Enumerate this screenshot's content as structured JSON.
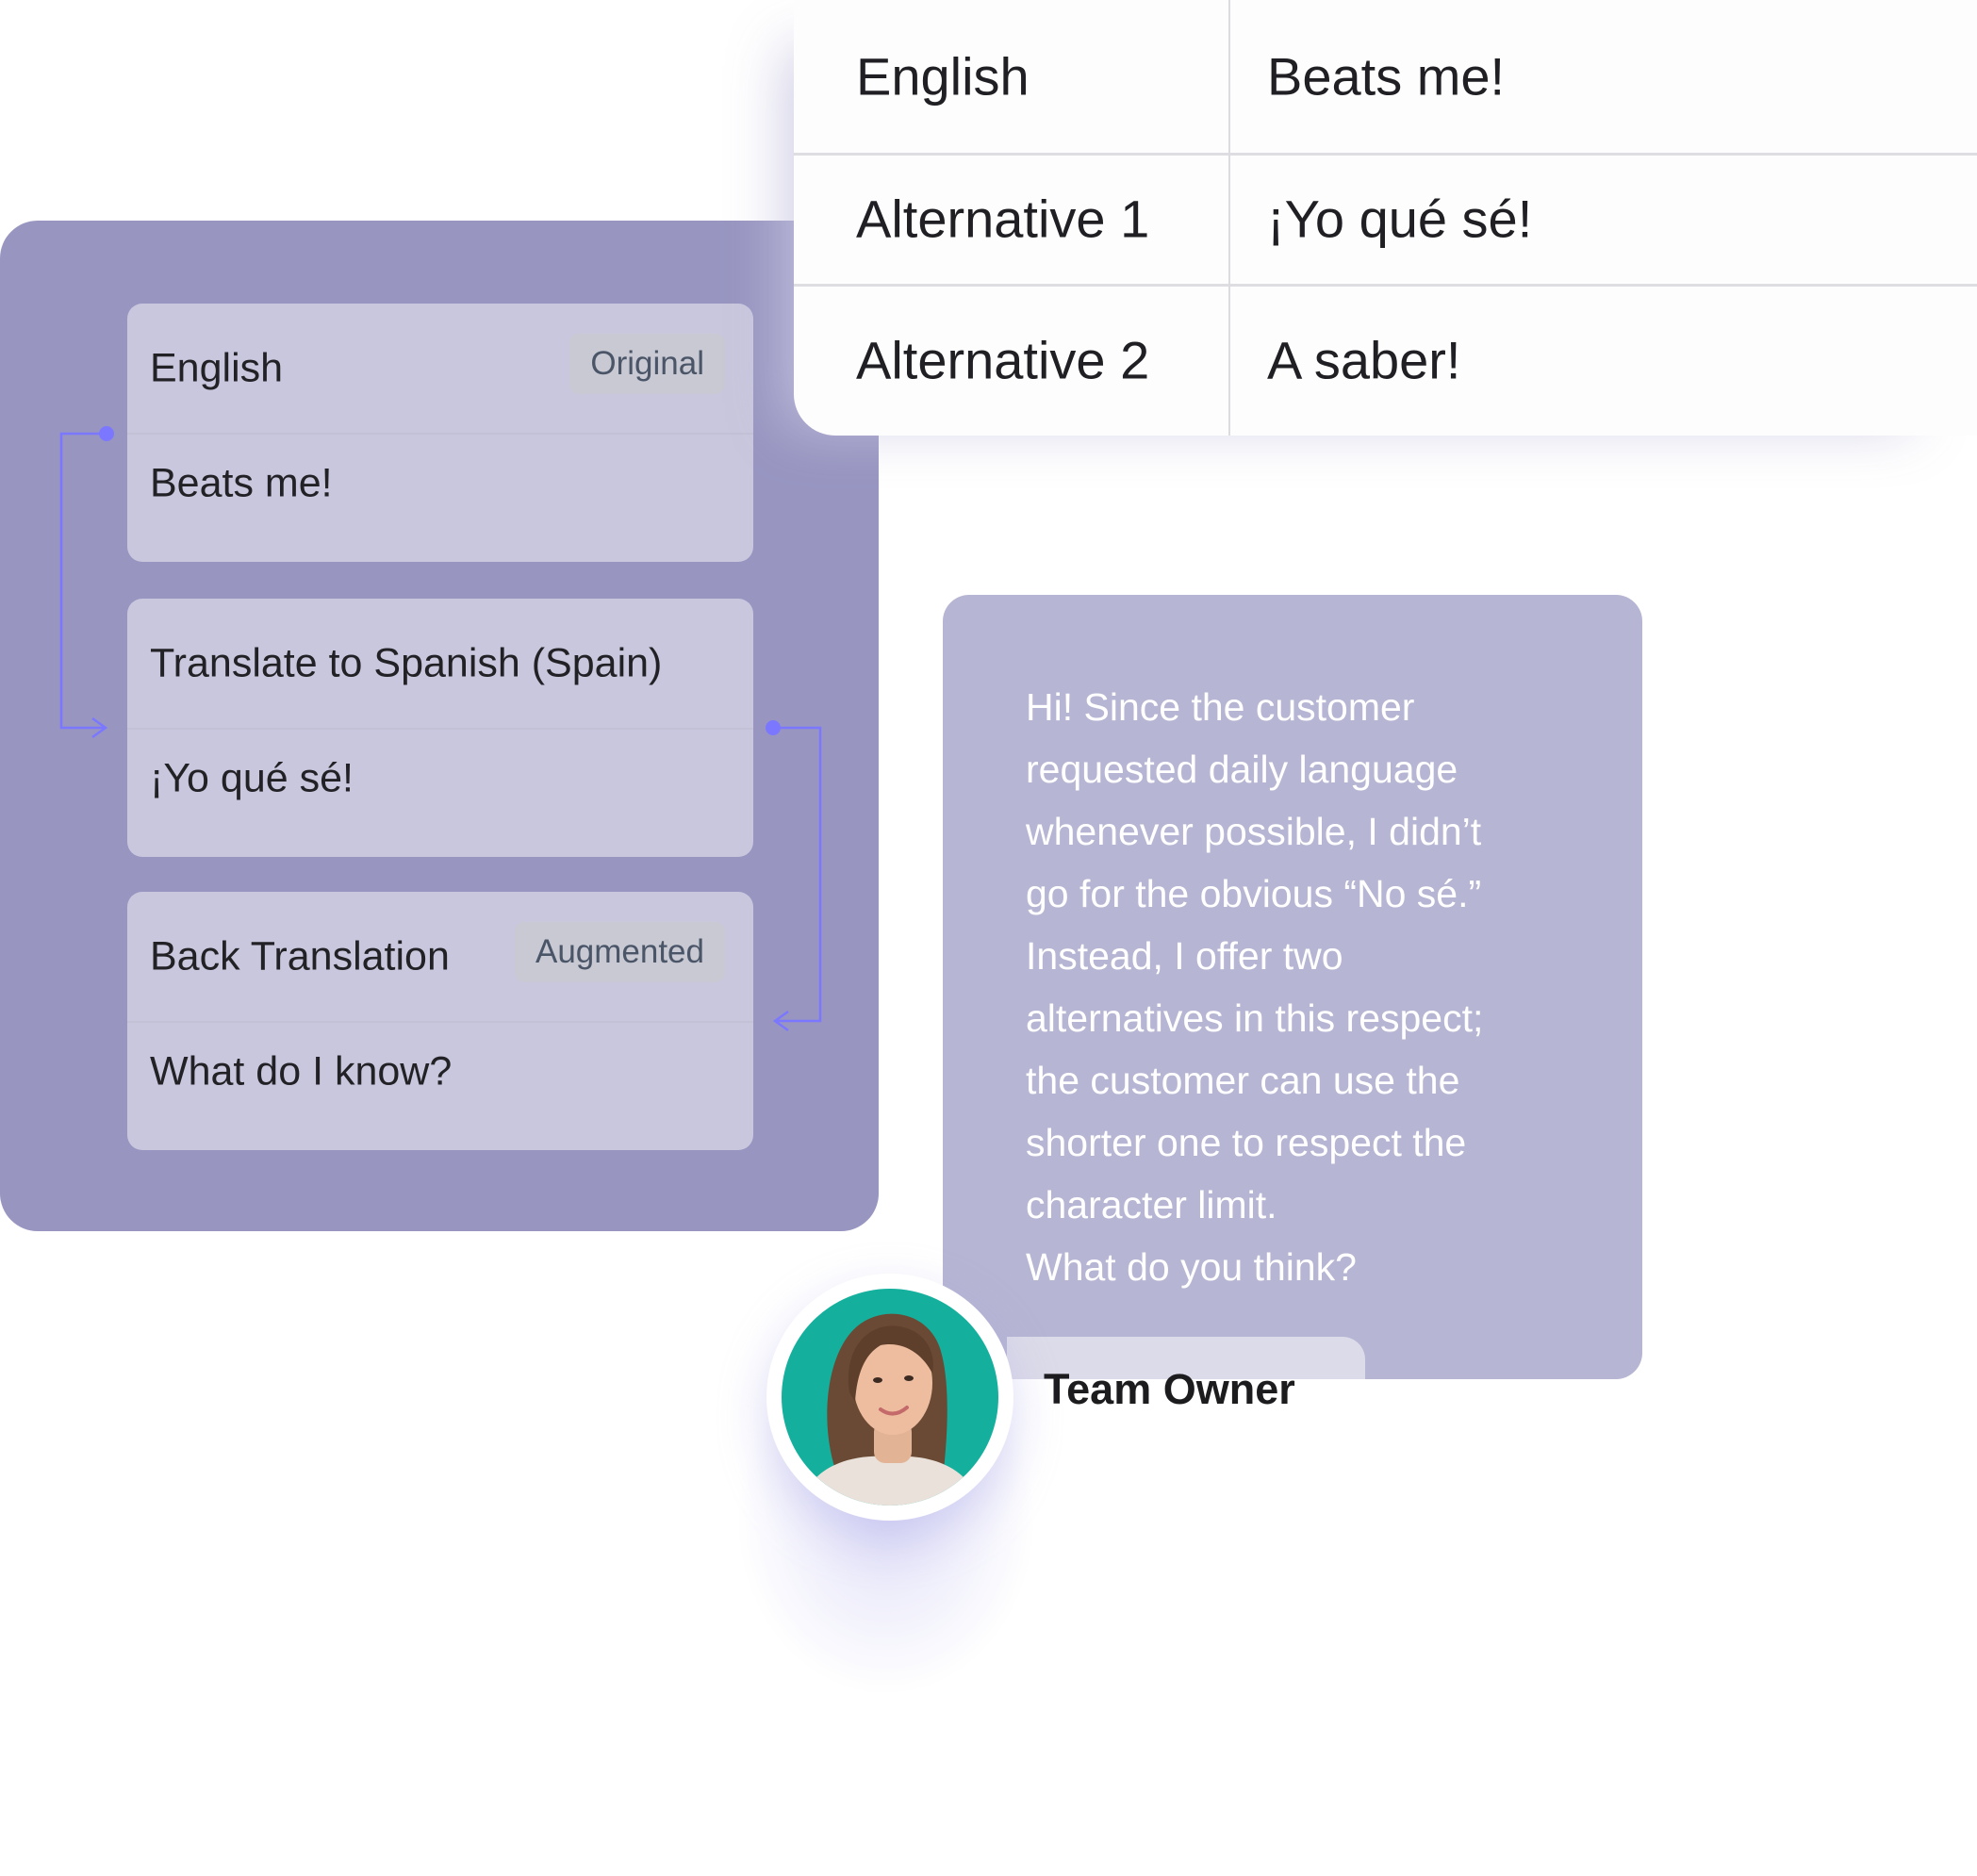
{
  "workflow": {
    "steps": [
      {
        "title": "English",
        "badge": "Original",
        "value": "Beats me!"
      },
      {
        "title": "Translate to Spanish (Spain)",
        "badge": null,
        "value": "¡Yo qué sé!"
      },
      {
        "title": "Back Translation",
        "badge": "Augmented",
        "value": "What do I know?"
      }
    ],
    "colors": {
      "panel": "#9896c1",
      "card": "#c9c7dd",
      "connector": "#7b78ff"
    }
  },
  "translations_table": {
    "rows": [
      {
        "label": "English",
        "value": "Beats me!"
      },
      {
        "label": "Alternative 1",
        "value": "¡Yo qué sé!"
      },
      {
        "label": "Alternative 2",
        "value": "A saber!"
      }
    ]
  },
  "comment": {
    "lines": [
      "Hi! Since the customer",
      "requested daily language",
      "whenever possible, I didn’t",
      "go for the obvious “No sé.”",
      "Instead, I offer two",
      "alternatives in this respect;",
      "the customer can use the",
      "shorter one to respect the",
      "character limit.",
      "What do you think?"
    ],
    "author_role": "Team Owner",
    "avatar_icon": "user-photo-avatar",
    "colors": {
      "bubble": "#b6b5d3",
      "avatar_bg": "#15b09d"
    }
  }
}
